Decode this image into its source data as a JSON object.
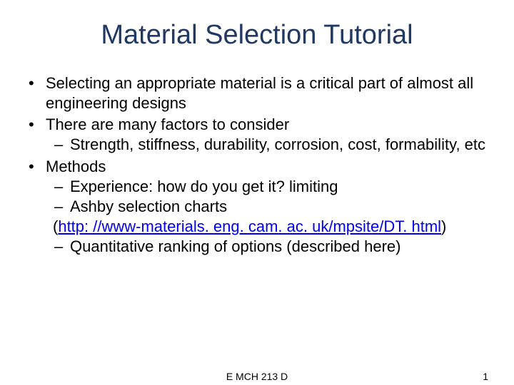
{
  "title": "Material Selection Tutorial",
  "bullets": {
    "b1": "Selecting an appropriate material is a critical part of almost all engineering designs",
    "b2": "There are many factors to consider",
    "b2_sub1": "Strength, stiffness, durability, corrosion, cost, formability, etc",
    "b3": "Methods",
    "b3_sub1": "Experience:  how do you get it?  limiting",
    "b3_sub2": "Ashby selection charts",
    "b3_paren_open": "(",
    "b3_link": "http: //www-materials. eng. cam. ac. uk/mpsite/DT. html",
    "b3_paren_close": ")",
    "b3_sub3": "Quantitative ranking of options (described here)"
  },
  "footer": {
    "center": "E MCH 213 D",
    "page": "1"
  }
}
